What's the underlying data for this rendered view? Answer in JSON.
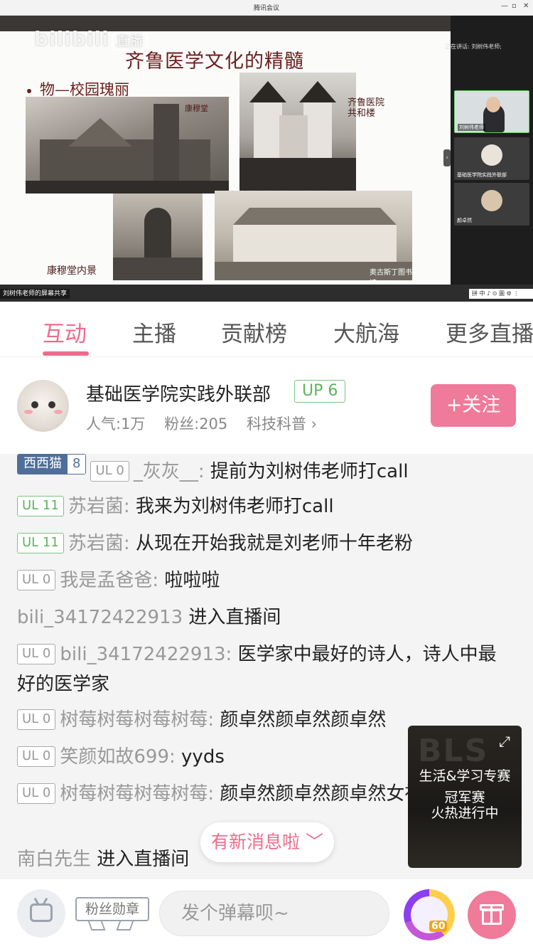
{
  "video": {
    "window_title": "腾讯会议",
    "platform_watermark": "bilibili",
    "platform_watermark_tag": "直播",
    "slide": {
      "title": "齐鲁医学文化的精髓",
      "bullet": "物—校园瑰丽",
      "captions": {
        "kangmu_hall": "康穆堂",
        "hospital_building": "齐鲁医院\n共和楼",
        "kangmu_interior": "康穆堂内景",
        "library": "奥古斯丁图书馆"
      }
    },
    "speaking_label": "正在讲话: 刘树伟老师;",
    "participants": [
      {
        "name": "刘树伟老师"
      },
      {
        "name": "基础医学院实践外联部"
      },
      {
        "name": "颜卓然"
      }
    ],
    "screen_share_label": "刘树伟老师的屏幕共享",
    "toolbar_text": "拼 中 ♪ ⊙ 圖 ⚙ ⋮"
  },
  "tabs": [
    {
      "label": "互动",
      "active": true
    },
    {
      "label": "主播",
      "active": false
    },
    {
      "label": "贡献榜",
      "active": false
    },
    {
      "label": "大航海",
      "active": false
    },
    {
      "label": "更多直播",
      "active": false
    }
  ],
  "streamer": {
    "name": "基础医学院实践外联部",
    "up_level": "UP 6",
    "popularity": "人气:1万",
    "fans": "粉丝:205",
    "category": "科技科普 ›",
    "follow_label": "+关注"
  },
  "chat": [
    {
      "medal": {
        "name": "西西猫",
        "level": "8"
      },
      "ul": "UL 0",
      "ul_color": "gray",
      "user": "_灰灰__:",
      "text": "提前为刘树伟老师打call"
    },
    {
      "ul": "UL 11",
      "ul_color": "green",
      "user": "苏岩菌:",
      "text": "我来为刘树伟老师打call"
    },
    {
      "ul": "UL 11",
      "ul_color": "green",
      "user": "苏岩菌:",
      "text": "从现在开始我就是刘老师十年老粉"
    },
    {
      "ul": "UL 0",
      "ul_color": "gray",
      "user": "我是孟爸爸:",
      "text": "啦啦啦"
    },
    {
      "user": "bili_34172422913",
      "text": "进入直播间"
    },
    {
      "ul": "UL 0",
      "ul_color": "gray",
      "user": "bili_34172422913:",
      "text": "医学家中最好的诗人，诗人中最好的医学家"
    },
    {
      "ul": "UL 0",
      "ul_color": "gray",
      "user": "树莓树莓树莓树莓:",
      "text": "颜卓然颜卓然颜卓然"
    },
    {
      "ul": "UL 0",
      "ul_color": "gray",
      "user": "笑颜如故699:",
      "text": "yyds"
    },
    {
      "ul": "UL 0",
      "ul_color": "gray",
      "user": "树莓树莓树莓树莓:",
      "text": "颜卓然颜卓然颜卓然女神"
    },
    {
      "user": "南白先生",
      "text": "进入直播间"
    }
  ],
  "promo": {
    "logo_text": "BLS",
    "line1": "生活&学习专赛",
    "line2": "冠军赛",
    "line3": "火热进行中"
  },
  "new_message_pill": "有新消息啦 ﹀",
  "bottom": {
    "fan_medal_label": "粉丝勋章",
    "danmaku_placeholder": "发个弹幕呗~",
    "speed_badge": "60"
  }
}
